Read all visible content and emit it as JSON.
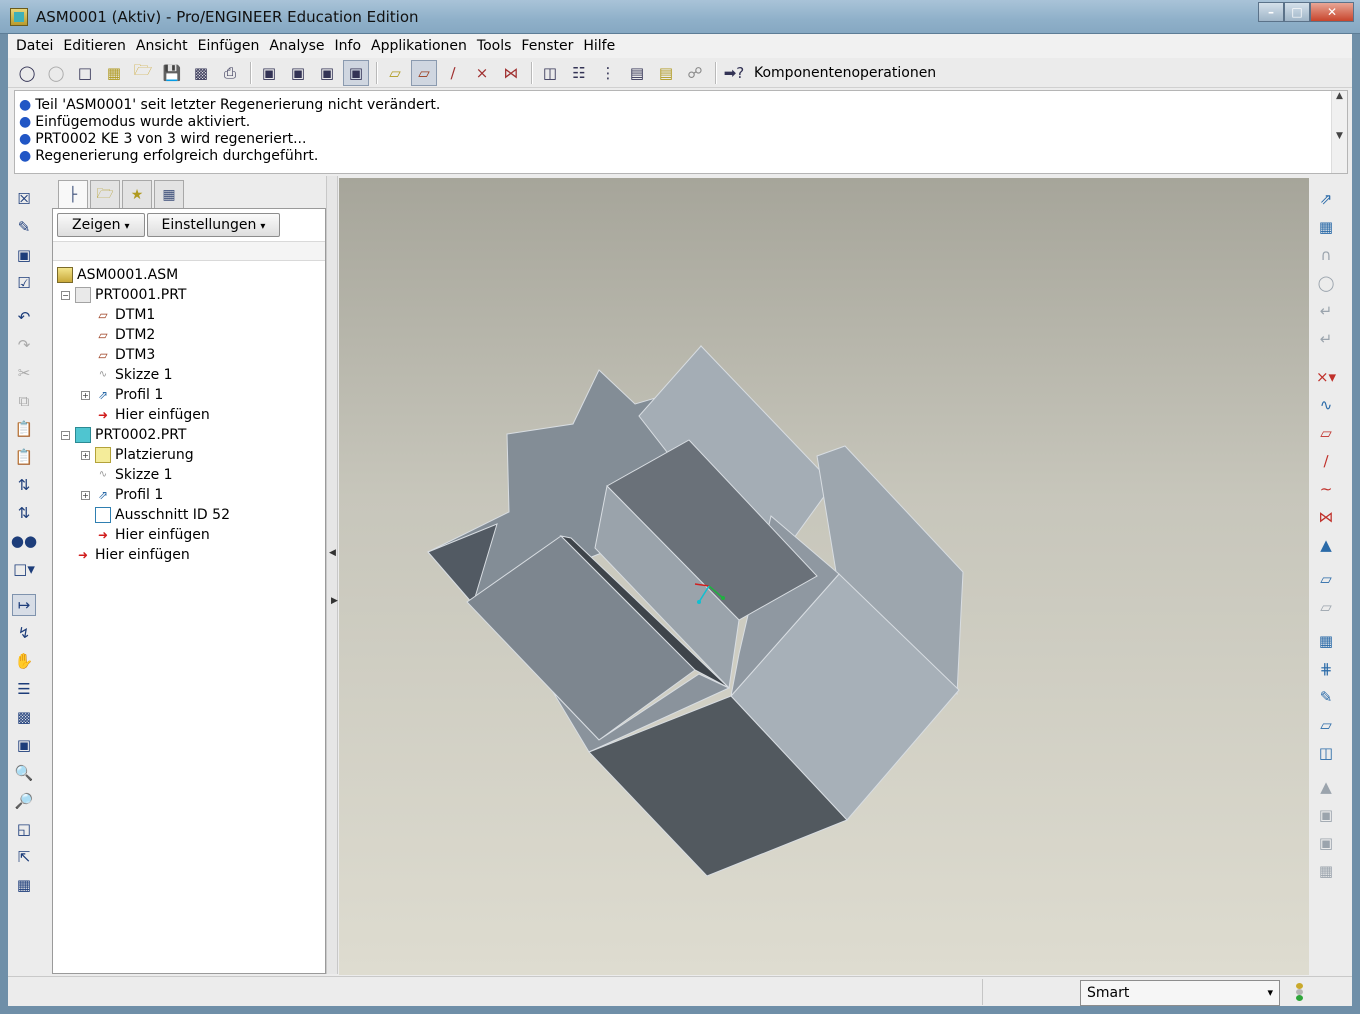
{
  "window": {
    "title": "ASM0001 (Aktiv) - Pro/ENGINEER Education Edition"
  },
  "menu": [
    {
      "label": "Datei"
    },
    {
      "label": "Editieren"
    },
    {
      "label": "Ansicht"
    },
    {
      "label": "Einfügen"
    },
    {
      "label": "Analyse"
    },
    {
      "label": "Info"
    },
    {
      "label": "Applikationen"
    },
    {
      "label": "Tools"
    },
    {
      "label": "Fenster"
    },
    {
      "label": "Hilfe"
    }
  ],
  "toolbar": {
    "component_ops_label": "Komponentenoperationen"
  },
  "messages": [
    "Teil 'ASM0001' seit letzter Regenerierung nicht verändert.",
    "Einfügemodus wurde aktiviert.",
    "PRT0002 KE 3 von 3 wird regeneriert...",
    "Regenerierung erfolgreich durchgeführt."
  ],
  "panel": {
    "show_button": "Zeigen",
    "settings_button": "Einstellungen",
    "tree": [
      "ASM0001.ASM",
      "PRT0001.PRT",
      "DTM1",
      "DTM2",
      "DTM3",
      "Skizze 1",
      "Profil 1",
      "Hier einfügen",
      "PRT0002.PRT",
      "Platzierung",
      "Skizze 1",
      "Profil 1",
      "Ausschnitt ID 52",
      "Hier einfügen",
      "Hier einfügen"
    ]
  },
  "status": {
    "filter_value": "Smart"
  },
  "colors": {
    "accent": "#2156c5",
    "viewport_top": "#a6a59a",
    "viewport_bottom": "#dedcd0"
  }
}
